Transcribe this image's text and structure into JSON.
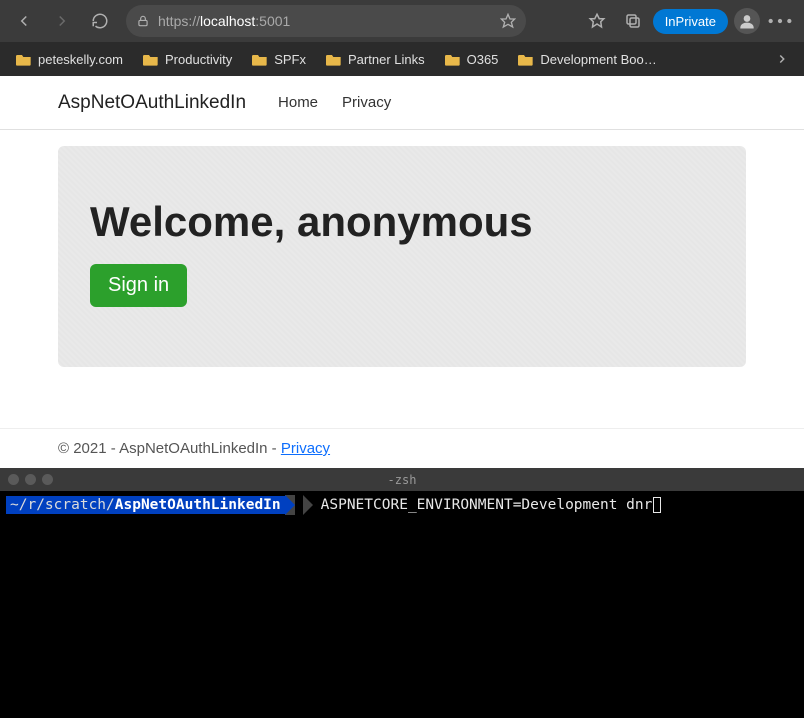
{
  "browser": {
    "url_prefix": "https://",
    "url_host": "localhost",
    "url_port": ":5001",
    "inprivate_label": "InPrivate"
  },
  "bookmarks": [
    {
      "label": "peteskelly.com"
    },
    {
      "label": "Productivity"
    },
    {
      "label": "SPFx"
    },
    {
      "label": "Partner Links"
    },
    {
      "label": "O365"
    },
    {
      "label": "Development Boo…"
    }
  ],
  "page": {
    "brand": "AspNetOAuthLinkedIn",
    "nav": {
      "home": "Home",
      "privacy": "Privacy"
    },
    "hero_heading": "Welcome, anonymous",
    "signin_label": "Sign in",
    "footer_text": "© 2021 - AspNetOAuthLinkedIn - ",
    "footer_link": "Privacy"
  },
  "terminal": {
    "title": "-zsh",
    "prompt_path_prefix": "~/r/scratch/",
    "prompt_path_hl": "AspNetOAuthLinkedIn",
    "command": "ASPNETCORE_ENVIRONMENT=Development dnr"
  }
}
